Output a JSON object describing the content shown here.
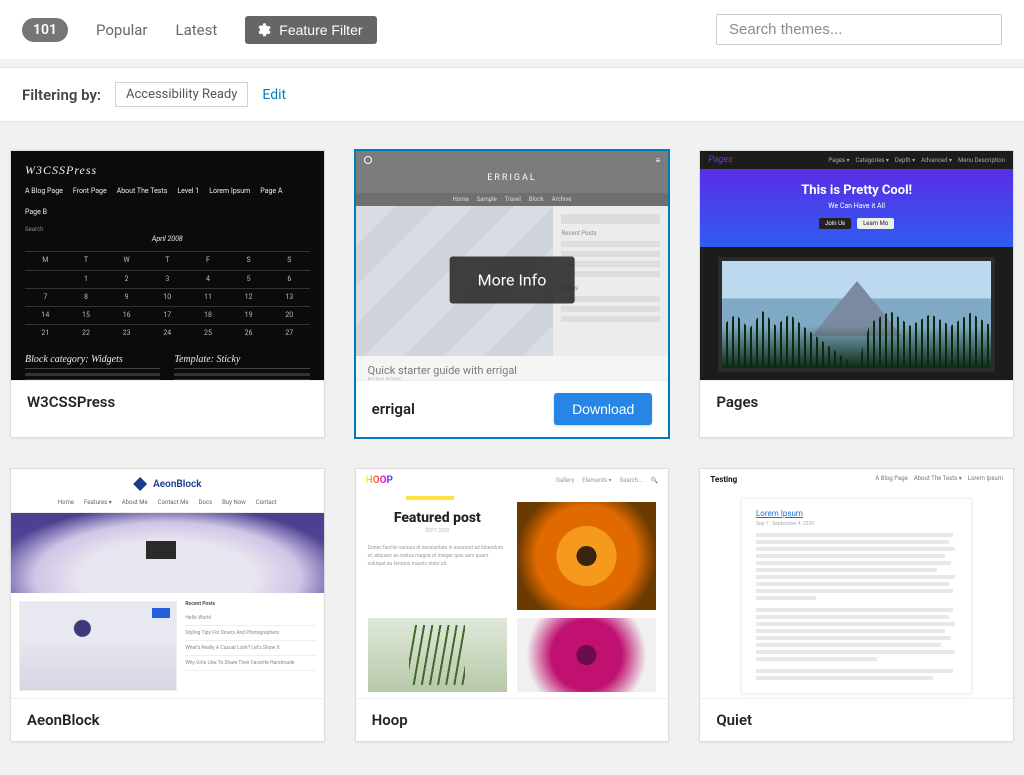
{
  "toolbar": {
    "count": "101",
    "tabs": {
      "popular": "Popular",
      "latest": "Latest"
    },
    "feature_filter": "Feature Filter",
    "search_placeholder": "Search themes..."
  },
  "filter": {
    "label": "Filtering by:",
    "tag": "Accessibility Ready",
    "edit": "Edit"
  },
  "hover": {
    "more_info": "More Info",
    "download": "Download"
  },
  "themes": [
    {
      "name": "W3CSSPress"
    },
    {
      "name": "errigal"
    },
    {
      "name": "Pages"
    },
    {
      "name": "AeonBlock"
    },
    {
      "name": "Hoop"
    },
    {
      "name": "Quiet"
    }
  ],
  "mock": {
    "w3": {
      "title": "W3CSSPress",
      "col1": "Block category: Widgets",
      "col2": "Template: Sticky"
    },
    "errigal": {
      "title": "ERRIGAL",
      "subtitle": "Quick starter guide with errigal"
    },
    "pages": {
      "logo": "Pages",
      "hero": "This is Pretty Cool!",
      "sub": "We Can Have it All",
      "b1": "Join Us",
      "b2": "Learn Mo"
    },
    "aeon": {
      "brand": "AeonBlock",
      "recent": "Recent Posts"
    },
    "hoop": {
      "brand": "HOOP",
      "fp": "Featured post"
    },
    "quiet": {
      "brand": "Testing",
      "link": "Lorem Ipsum"
    }
  }
}
